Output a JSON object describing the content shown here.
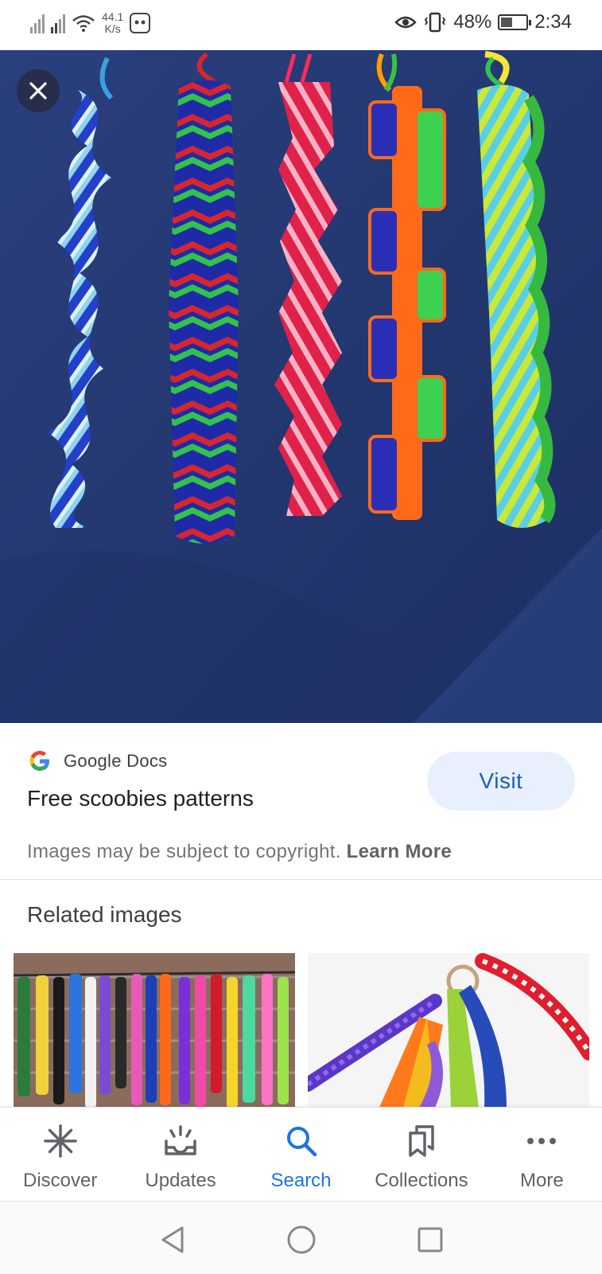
{
  "status_bar": {
    "net_speed_value": "44.1",
    "net_speed_unit": "K/s",
    "battery": "48%",
    "battery_level": 0.48,
    "time": "2:34"
  },
  "hero": {
    "close_icon": "close-icon",
    "background_color": "#253a75"
  },
  "result": {
    "source_icon": "google-g-logo",
    "source_name": "Google Docs",
    "title": "Free scoobies patterns",
    "visit_label": "Visit",
    "copyright_text": "Images may be subject to copyright.",
    "learn_more": "Learn More"
  },
  "related": {
    "heading": "Related images"
  },
  "bottom_nav": {
    "items": [
      {
        "label": "Discover",
        "icon": "discover-asterisk-icon",
        "active": false
      },
      {
        "label": "Updates",
        "icon": "updates-inbox-icon",
        "active": false
      },
      {
        "label": "Search",
        "icon": "search-icon",
        "active": true
      },
      {
        "label": "Collections",
        "icon": "collections-bookmark-icon",
        "active": false
      },
      {
        "label": "More",
        "icon": "more-dots-icon",
        "active": false
      }
    ]
  },
  "colors": {
    "accent": "#1a73e8",
    "visit_bg": "#e8f0fe"
  }
}
